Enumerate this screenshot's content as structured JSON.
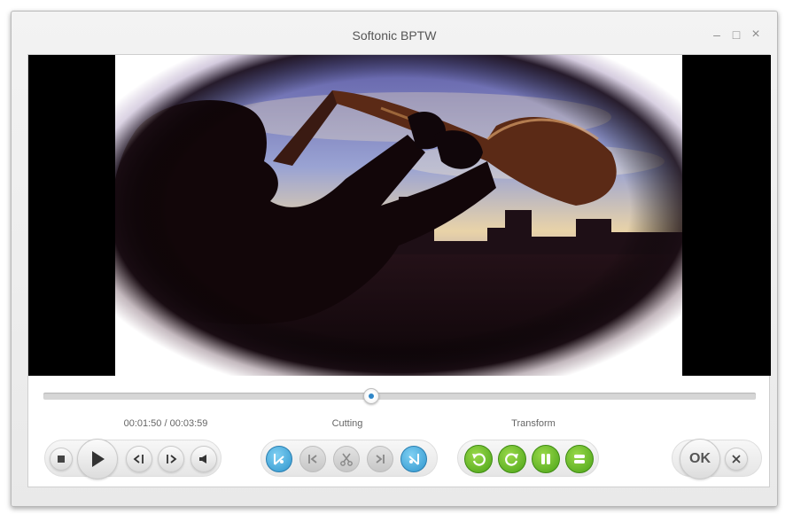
{
  "window": {
    "title": "Softonic BPTW",
    "minimize_icon": "minimize-icon",
    "maximize_icon": "maximize-icon",
    "close_icon": "close-icon"
  },
  "player": {
    "time_display": "00:01:50 / 00:03:59",
    "progress_fraction": 0.46,
    "controls": [
      "stop-icon",
      "play-icon",
      "previous-frame-icon",
      "next-frame-icon",
      "volume-icon"
    ]
  },
  "cutting": {
    "label": "Cutting",
    "controls": [
      "mark-start-icon",
      "go-to-start-icon",
      "scissors-icon",
      "go-to-end-icon",
      "mark-end-icon"
    ]
  },
  "transform": {
    "label": "Transform",
    "controls": [
      "rotate-left-icon",
      "rotate-right-icon",
      "flip-horizontal-icon",
      "flip-vertical-icon"
    ]
  },
  "actions": {
    "ok_label": "OK",
    "cancel_icon": "cancel-icon"
  },
  "colors": {
    "accent_blue": "#2f95cd",
    "accent_green": "#4aa317",
    "seek_thumb_dot": "#2f86c8"
  }
}
